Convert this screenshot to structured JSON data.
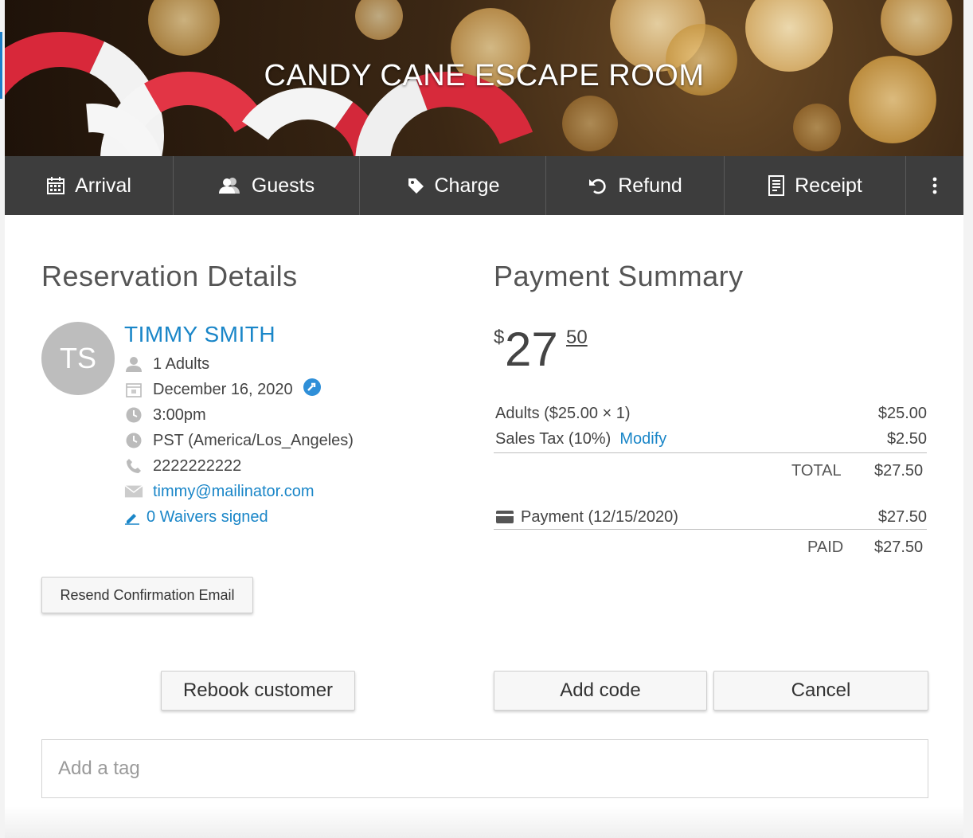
{
  "hero": {
    "title": "CANDY CANE ESCAPE ROOM"
  },
  "toolbar": {
    "arrival": "Arrival",
    "guests": "Guests",
    "charge": "Charge",
    "refund": "Refund",
    "receipt": "Receipt",
    "more_icon": "vertical-dots-icon"
  },
  "reservation": {
    "heading": "Reservation Details",
    "initials": "TS",
    "name": "TIMMY SMITH",
    "guests": "1 Adults",
    "date": "December 16, 2020",
    "time": "3:00pm",
    "timezone": "PST (America/Los_Angeles)",
    "phone": "2222222222",
    "email": "timmy@mailinator.com",
    "waivers": "0 Waivers signed",
    "resend_label": "Resend Confirmation Email",
    "rebook_label": "Rebook customer"
  },
  "payment": {
    "heading": "Payment Summary",
    "currency": "$",
    "amount_whole": "27",
    "amount_cents": "50",
    "lines": [
      {
        "label": "Adults ($25.00 × 1)",
        "value": "$25.00"
      },
      {
        "label": "Sales Tax (10%)",
        "modify": "Modify",
        "value": "$2.50"
      }
    ],
    "total_label": "TOTAL",
    "total_value": "$27.50",
    "payment_label": "Payment (12/15/2020)",
    "payment_value": "$27.50",
    "paid_label": "PAID",
    "paid_value": "$27.50",
    "add_code_label": "Add code",
    "cancel_label": "Cancel"
  },
  "tags": {
    "placeholder": "Add a tag"
  },
  "colors": {
    "accent": "#1a86c8",
    "toolbar": "#3d3d3d",
    "avatar": "#bdbdbd"
  }
}
